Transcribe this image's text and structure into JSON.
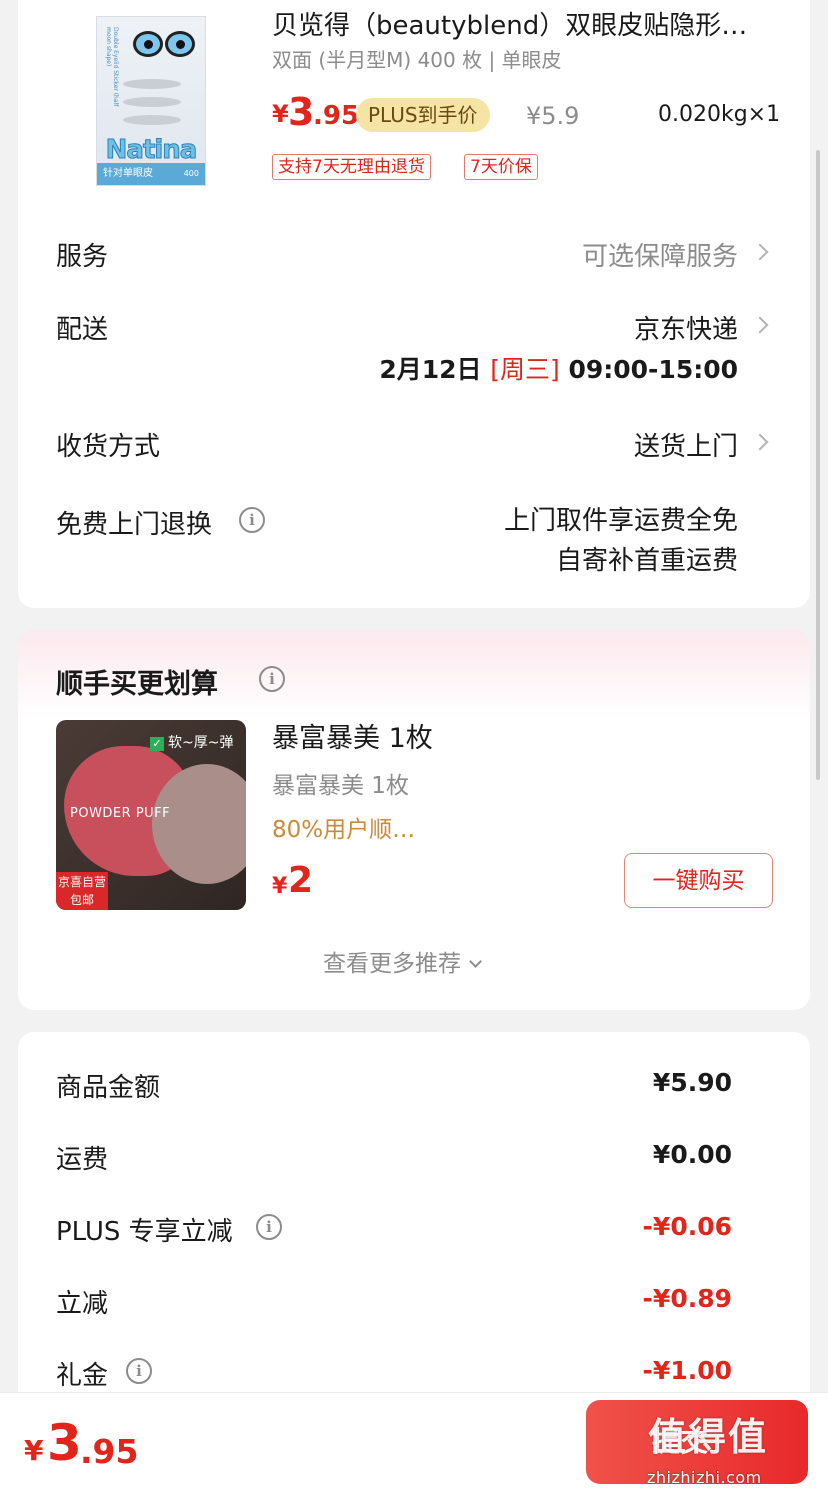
{
  "product": {
    "title": "贝览得（beautyblend）双眼皮贴隐形…",
    "spec": "双面 (半月型M) 400 枚 | 单眼皮",
    "price_symbol": "¥",
    "price_int": "3",
    "price_dec": ".95",
    "plus_tag": "PLUS到手价",
    "original_price": "¥5.9",
    "weight_qty": "0.020kg×1",
    "tags": [
      "支持7天无理由退货",
      "7天价保"
    ],
    "image": {
      "brand": "Natina",
      "band_text": "针对单眼皮",
      "band_count": "400",
      "side_text": "Double Eyelid Sticker (half moon shape)"
    }
  },
  "service": {
    "label": "服务",
    "value": "可选保障服务"
  },
  "delivery": {
    "label": "配送",
    "value": "京东快递",
    "date": "2月12日",
    "weekday": "[周三]",
    "time": "09:00-15:00"
  },
  "receive": {
    "label": "收货方式",
    "value": "送货上门"
  },
  "free_return": {
    "label": "免费上门退换",
    "line1": "上门取件享运费全免",
    "line2": "自寄补首重运费"
  },
  "recommend": {
    "title": "顺手买更划算",
    "item_name": "暴富暴美 1枚",
    "item_sub": "暴富暴美 1枚",
    "item_rate": "80%用户顺…",
    "price_symbol": "¥",
    "price": "2",
    "buy_label": "一键购买",
    "more_label": "查看更多推荐",
    "image": {
      "check_text": "软~厚~弹",
      "puff_text": "POWDER PUFF",
      "jd_line1": "京喜自营",
      "jd_line2": "包邮"
    }
  },
  "fees": [
    {
      "label": "商品金额",
      "value": "¥5.90",
      "red": false,
      "info": false
    },
    {
      "label": "运费",
      "value": "¥0.00",
      "red": false,
      "info": false
    },
    {
      "label": "PLUS 专享立减",
      "value": "-¥0.06",
      "red": true,
      "info": true
    },
    {
      "label": "立减",
      "value": "-¥0.89",
      "red": true,
      "info": false
    },
    {
      "label": "礼金",
      "value": "-¥1.00",
      "red": true,
      "info": true
    }
  ],
  "bottom": {
    "total_symbol": "¥",
    "total_int": "3",
    "total_dec": ".95",
    "pay_label": "提交",
    "watermark": "值得值",
    "watermark_url": "zhizhizhi.com"
  },
  "colors": {
    "accent_red": "#e1251b",
    "plus_gold": "#f6e3a6",
    "rate_orange": "#c98a3a"
  },
  "icons": {
    "info": "info-circle-icon",
    "chevron": "chevron-right-icon",
    "expand": "chevron-down-icon"
  }
}
